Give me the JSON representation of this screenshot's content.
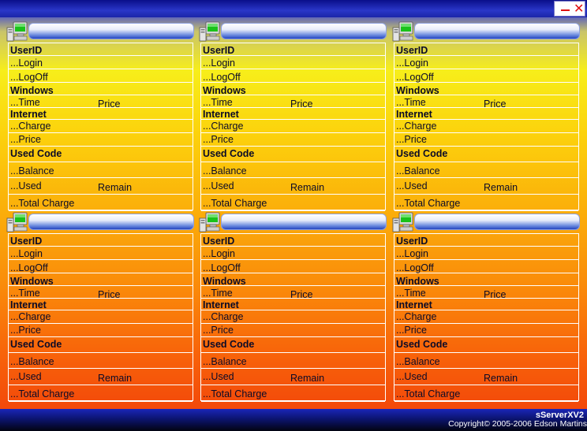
{
  "window": {
    "close_glyph": "✕",
    "icons": [
      "minimize-icon",
      "close-icon"
    ],
    "accent": "#1a2bd0"
  },
  "labels": {
    "userid": "UserID",
    "login": "...Login",
    "logoff": "...LogOff",
    "windows": "Windows",
    "time": "...Time",
    "price_right": "Price",
    "internet": "Internet",
    "charge": "...Charge",
    "price": "...Price",
    "used_code": "Used Code",
    "balance": "...Balance",
    "used": "...Used",
    "remain": "Remain",
    "total_charge": "...Total Charge"
  },
  "panels": [
    {
      "station_name": ""
    },
    {
      "station_name": ""
    },
    {
      "station_name": ""
    },
    {
      "station_name": ""
    },
    {
      "station_name": ""
    },
    {
      "station_name": ""
    }
  ],
  "footer": {
    "product": "sServerXV2",
    "copyright": "Copyright© 2005-2006 Edson Martins"
  }
}
